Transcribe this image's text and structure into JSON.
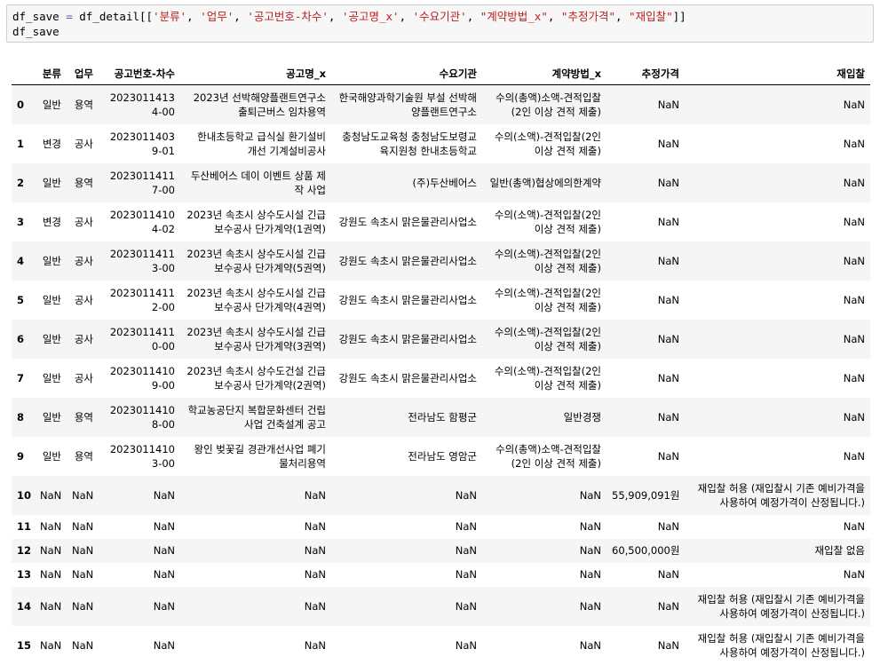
{
  "code": {
    "line1_var": "df_save",
    "line1_op": " = ",
    "line1_df": "df_detail[[",
    "line1_cols": [
      "'분류'",
      "'업무'",
      "'공고번호-차수'",
      "'공고명_x'",
      "'수요기관'",
      "\"계약방법_x\"",
      "\"추정가격\"",
      "\"재입찰\""
    ],
    "line1_end": "]]",
    "line2": "df_save"
  },
  "table": {
    "columns": [
      "",
      "분류",
      "업무",
      "공고번호-차수",
      "공고명_x",
      "수요기관",
      "계약방법_x",
      "추정가격",
      "재입찰"
    ],
    "rows": [
      [
        "0",
        "일반",
        "용역",
        "20230114134-00",
        "2023년 선박해양플랜트연구소 출퇴근버스 임차용역",
        "한국해양과학기술원 부설 선박해양플랜트연구소",
        "수의(총액)소액-견적입찰(2인 이상 견적 제출)",
        "NaN",
        "NaN"
      ],
      [
        "1",
        "변경",
        "공사",
        "20230114039-01",
        "한내초등학교 급식실 환기설비 개선 기계설비공사",
        "충청남도교육청 충청남도보령교육지원청 한내초등학교",
        "수의(소액)-견적입찰(2인 이상 견적 제출)",
        "NaN",
        "NaN"
      ],
      [
        "2",
        "일반",
        "용역",
        "20230114117-00",
        "두산베어스 데이 이벤트 상품 제작 사업",
        "(주)두산베어스",
        "일반(총액)협상에의한계약",
        "NaN",
        "NaN"
      ],
      [
        "3",
        "변경",
        "공사",
        "20230114104-02",
        "2023년 속초시 상수도시설 긴급 보수공사 단가계약(1권역)",
        "강원도 속초시 맑은물관리사업소",
        "수의(소액)-견적입찰(2인 이상 견적 제출)",
        "NaN",
        "NaN"
      ],
      [
        "4",
        "일반",
        "공사",
        "20230114113-00",
        "2023년 속초시 상수도시설 긴급 보수공사 단가계약(5권역)",
        "강원도 속초시 맑은물관리사업소",
        "수의(소액)-견적입찰(2인 이상 견적 제출)",
        "NaN",
        "NaN"
      ],
      [
        "5",
        "일반",
        "공사",
        "20230114112-00",
        "2023년 속초시 상수도시설 긴급 보수공사 단가계약(4권역)",
        "강원도 속초시 맑은물관리사업소",
        "수의(소액)-견적입찰(2인 이상 견적 제출)",
        "NaN",
        "NaN"
      ],
      [
        "6",
        "일반",
        "공사",
        "20230114110-00",
        "2023년 속초시 상수도시설 긴급 보수공사 단가계약(3권역)",
        "강원도 속초시 맑은물관리사업소",
        "수의(소액)-견적입찰(2인 이상 견적 제출)",
        "NaN",
        "NaN"
      ],
      [
        "7",
        "일반",
        "공사",
        "20230114109-00",
        "2023년 속초시 상수도건설 긴급 보수공사 단가계약(2권역)",
        "강원도 속초시 맑은물관리사업소",
        "수의(소액)-견적입찰(2인 이상 견적 제출)",
        "NaN",
        "NaN"
      ],
      [
        "8",
        "일반",
        "용역",
        "20230114108-00",
        "학교농공단지 복합문화센터 건립사업 건축설계 공고",
        "전라남도 함평군",
        "일반경쟁",
        "NaN",
        "NaN"
      ],
      [
        "9",
        "일반",
        "용역",
        "20230114103-00",
        "왕인 벚꽃길 경관개선사업 폐기물처리용역",
        "전라남도 영암군",
        "수의(총액)소액-견적입찰(2인 이상 견적 제출)",
        "NaN",
        "NaN"
      ],
      [
        "10",
        "NaN",
        "NaN",
        "NaN",
        "NaN",
        "NaN",
        "NaN",
        "55,909,091원",
        "재입찰 허용 (재입찰시 기존 예비가격을 사용하여 예정가격이 산정됩니다.)"
      ],
      [
        "11",
        "NaN",
        "NaN",
        "NaN",
        "NaN",
        "NaN",
        "NaN",
        "NaN",
        "NaN"
      ],
      [
        "12",
        "NaN",
        "NaN",
        "NaN",
        "NaN",
        "NaN",
        "NaN",
        "60,500,000원",
        "재입찰 없음"
      ],
      [
        "13",
        "NaN",
        "NaN",
        "NaN",
        "NaN",
        "NaN",
        "NaN",
        "NaN",
        "NaN"
      ],
      [
        "14",
        "NaN",
        "NaN",
        "NaN",
        "NaN",
        "NaN",
        "NaN",
        "NaN",
        "재입찰 허용 (재입찰시 기존 예비가격을 사용하여 예정가격이 산정됩니다.)"
      ],
      [
        "15",
        "NaN",
        "NaN",
        "NaN",
        "NaN",
        "NaN",
        "NaN",
        "NaN",
        "재입찰 허용 (재입찰시 기존 예비가격을 사용하여 예정가격이 산정됩니다.)"
      ]
    ]
  }
}
